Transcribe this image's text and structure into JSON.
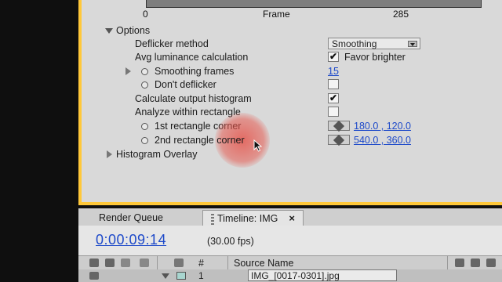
{
  "graph": {
    "x_start": "0",
    "x_end": "285",
    "x_label": "Frame"
  },
  "options": {
    "header": "Options",
    "deflicker_method": {
      "label": "Deflicker method",
      "value": "Smoothing"
    },
    "avg_luminance": {
      "label": "Avg luminance calculation",
      "checked": true,
      "checkbox_label": "Favor brighter"
    },
    "smoothing_frames": {
      "label": "Smoothing frames",
      "value": "15"
    },
    "dont_deflicker": {
      "label": "Don't deflicker",
      "checked": false
    },
    "output_histogram": {
      "label": "Calculate output histogram",
      "checked": true
    },
    "analyze_rect": {
      "label": "Analyze within rectangle",
      "checked": false
    },
    "rect_corner_1": {
      "label": "1st rectangle corner",
      "value": "180.0 , 120.0"
    },
    "rect_corner_2": {
      "label": "2nd rectangle corner",
      "value": "540.0 , 360.0"
    },
    "histogram_overlay": {
      "label": "Histogram Overlay"
    }
  },
  "tabs": [
    {
      "label": "Render Queue"
    },
    {
      "label": "Timeline: IMG",
      "close": "×"
    }
  ],
  "timeline": {
    "timecode": "0:00:09:14",
    "fps": "(30.00 fps)"
  },
  "columns": {
    "number": "#",
    "source_name": "Source Name"
  },
  "layer": {
    "number": "1",
    "source": "IMG_[0017-0301].jpg"
  },
  "colors": {
    "panel_border": "#ffc83a",
    "link_blue": "#1d49c9",
    "highlight_red": "#e6463c"
  },
  "icons": [
    "stopwatch-icon",
    "crosshair-icon",
    "eye-icon",
    "speaker-icon",
    "lock-icon",
    "pen-icon",
    "mouse-cursor-icon"
  ]
}
